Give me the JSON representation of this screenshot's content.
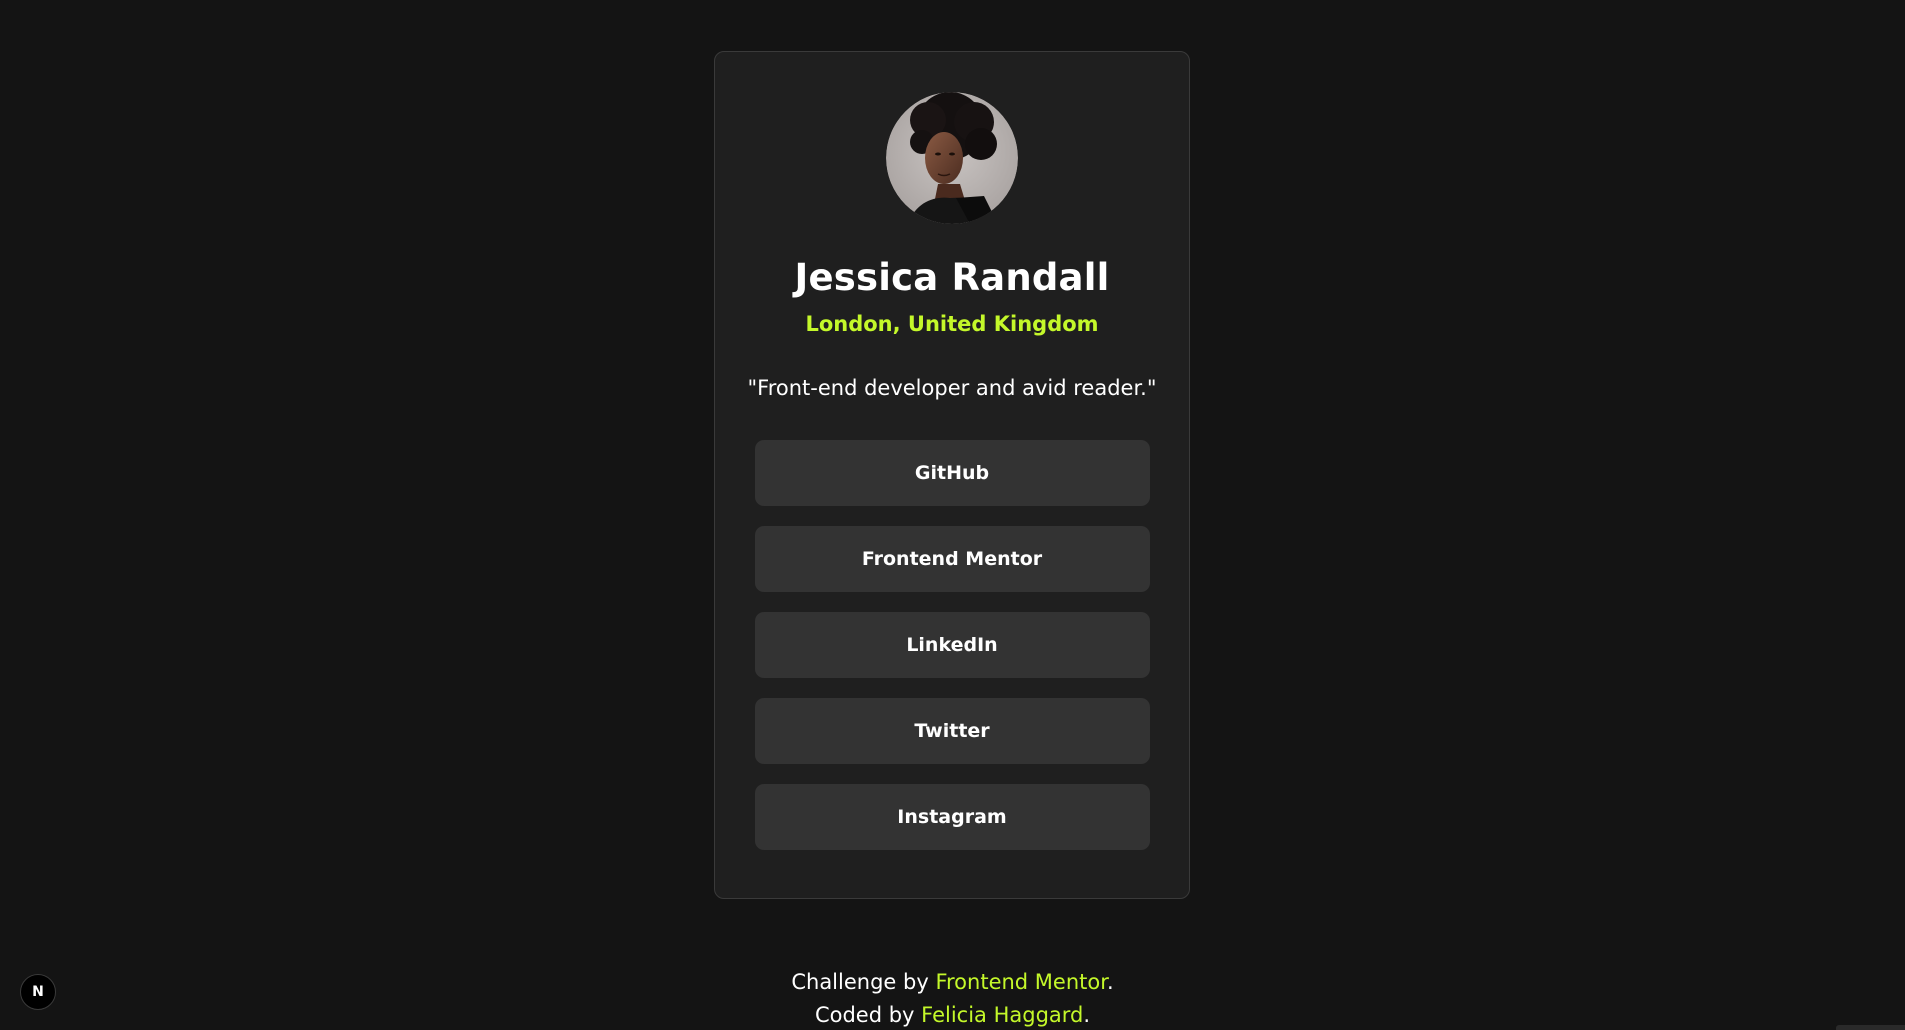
{
  "profile": {
    "avatar_icon": "profile-photo",
    "name": "Jessica Randall",
    "location": "London, United Kingdom",
    "bio": "\"Front-end developer and avid reader.\""
  },
  "links": [
    {
      "label": "GitHub"
    },
    {
      "label": "Frontend Mentor"
    },
    {
      "label": "LinkedIn"
    },
    {
      "label": "Twitter"
    },
    {
      "label": "Instagram"
    }
  ],
  "footer": {
    "line1_prefix": "Challenge by ",
    "line1_link": "Frontend Mentor",
    "line1_suffix": ".",
    "line2_prefix": "Coded by ",
    "line2_link": "Felicia Haggard",
    "line2_suffix": "."
  },
  "badge": {
    "label": "N",
    "icon": "nextjs-icon"
  },
  "colors": {
    "background": "#141414",
    "card": "#1f1f1f",
    "button": "#333333",
    "accent": "#c4f82a"
  }
}
